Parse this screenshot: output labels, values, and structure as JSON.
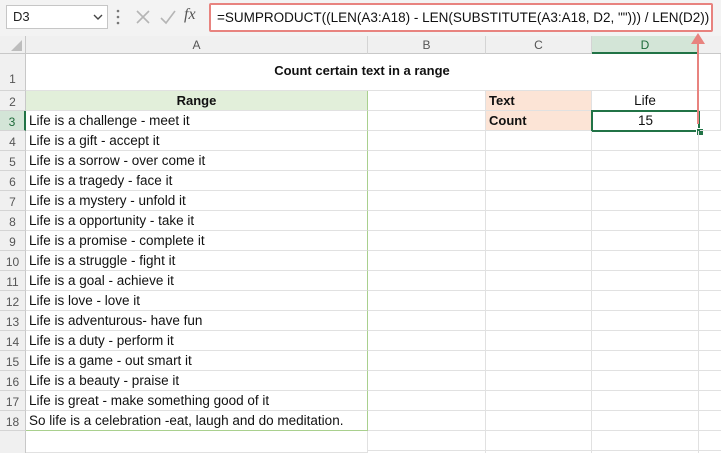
{
  "name_box": {
    "value": "D3"
  },
  "formula_bar": {
    "fx_label": "fx",
    "formula": "=SUMPRODUCT((LEN(A3:A18) - LEN(SUBSTITUTE(A3:A18, D2, \"\"))) / LEN(D2))"
  },
  "columns": [
    "A",
    "B",
    "C",
    "D"
  ],
  "rows": [
    "1",
    "2",
    "3",
    "4",
    "5",
    "6",
    "7",
    "8",
    "9",
    "10",
    "11",
    "12",
    "13",
    "14",
    "15",
    "16",
    "17",
    "18"
  ],
  "sheet": {
    "title": "Count certain text  in a range",
    "range_header": "Range",
    "range_values": [
      "Life is a challenge - meet it",
      "Life is a gift - accept it",
      "Life is a sorrow - over come it",
      "Life is a tragedy - face it",
      "Life is a mystery - unfold it",
      "Life is a opportunity - take it",
      "Life is a promise - complete it",
      "Life is a struggle - fight it",
      "Life is a goal - achieve it",
      "Life is love - love it",
      "Life is adventurous- have fun",
      "Life is a duty - perform it",
      "Life is a game - out smart it",
      "Life is a beauty - praise it",
      "Life is great - make something good of it",
      "So life is a celebration -eat, laugh and do meditation."
    ],
    "text_label": "Text",
    "text_value": "Life",
    "count_label": "Count",
    "count_value": "15"
  },
  "colors": {
    "accent": "#217346",
    "formula_highlight": "#e8837f",
    "peach": "#fce4d6",
    "green_fill": "#e2efda"
  }
}
